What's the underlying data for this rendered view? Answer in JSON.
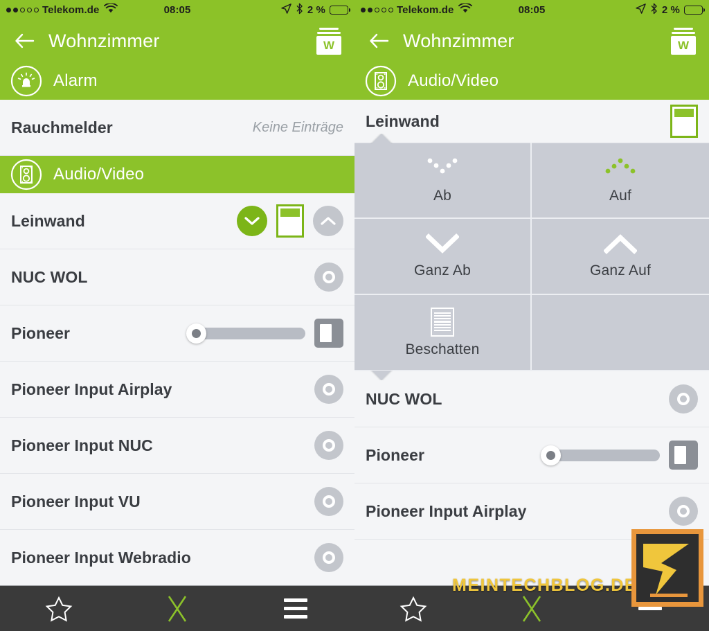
{
  "statusbar": {
    "carrier": "Telekom.de",
    "signal_dots_filled": 2,
    "signal_dots_total": 5,
    "wifi_icon": "wifi-icon",
    "time": "08:05",
    "location_icon": "location-arrow-icon",
    "bluetooth_icon": "bluetooth-icon",
    "battery_percent": "2 %",
    "battery_icon": "battery-empty-icon"
  },
  "navbar": {
    "back_icon": "back-arrow-icon",
    "title": "Wohnzimmer",
    "app_icon_letter": "W",
    "app_icon_name": "wiser-box-icon"
  },
  "colors": {
    "brand_green": "#8cc22a",
    "accent_green": "#7cb518",
    "panel_grey": "#c9ccd4",
    "row_bg": "#f4f5f7",
    "tabbar_bg": "#3a3a3a",
    "text_dark": "#3a3d42",
    "muted_text": "#9aa0a6",
    "watermark_yellow": "#f0c63c",
    "watermark_orange": "#e8963c"
  },
  "left_pane": {
    "categories": [
      {
        "label": "Alarm",
        "icon": "alarm-siren-icon",
        "active": true
      },
      {
        "label": "Audio/Video",
        "icon": "speaker-icon",
        "active": true
      }
    ],
    "alarm_rows": [
      {
        "name": "Rauchmelder",
        "note": "Keine Einträge",
        "control": "none"
      }
    ],
    "av_rows": [
      {
        "name": "Leinwand",
        "control": "screen-controls"
      },
      {
        "name": "NUC WOL",
        "control": "power-toggle"
      },
      {
        "name": "Pioneer",
        "control": "volume-slider"
      },
      {
        "name": "Pioneer Input Airplay",
        "control": "power-toggle"
      },
      {
        "name": "Pioneer Input NUC",
        "control": "power-toggle"
      },
      {
        "name": "Pioneer Input VU",
        "control": "power-toggle"
      },
      {
        "name": "Pioneer Input Webradio",
        "control": "power-toggle"
      }
    ],
    "leinwand_controls": {
      "down_button": "chevron-down-icon",
      "state_icon": "screen-partial-icon",
      "up_button": "chevron-up-icon"
    }
  },
  "right_pane": {
    "category": {
      "label": "Audio/Video",
      "icon": "speaker-icon"
    },
    "expanded_row": {
      "name": "Leinwand",
      "state_icon": "screen-partial-icon"
    },
    "panel_buttons": [
      {
        "label": "Ab",
        "icon": "dotted-chevron-down-icon",
        "icon_color": "#ffffff"
      },
      {
        "label": "Auf",
        "icon": "dotted-chevron-up-icon",
        "icon_color": "#8cc22a"
      },
      {
        "label": "Ganz Ab",
        "icon": "chevron-down-icon",
        "icon_color": "#ffffff"
      },
      {
        "label": "Ganz Auf",
        "icon": "chevron-up-icon",
        "icon_color": "#ffffff"
      },
      {
        "label": "Beschatten",
        "icon": "blinds-slats-icon",
        "icon_color": "#ffffff"
      },
      {
        "label": "",
        "icon": "",
        "icon_color": ""
      }
    ],
    "rows": [
      {
        "name": "NUC WOL",
        "control": "power-toggle"
      },
      {
        "name": "Pioneer",
        "control": "volume-slider"
      },
      {
        "name": "Pioneer Input Airplay",
        "control": "power-toggle"
      }
    ]
  },
  "tabbar": {
    "left_items": [
      {
        "icon": "star-icon",
        "color": "#ffffff"
      },
      {
        "icon": "x-icon",
        "color": "#8cc22a"
      },
      {
        "icon": "hamburger-menu-icon",
        "color": "#ffffff"
      }
    ],
    "right_items": [
      {
        "icon": "star-icon",
        "color": "#ffffff"
      },
      {
        "icon": "x-icon",
        "color": "#8cc22a"
      },
      {
        "icon": "minus-icon",
        "color": "#ffffff"
      }
    ]
  },
  "watermark": {
    "text": "MEINTECHBLOG.DE",
    "logo_name": "meintechblog-logo"
  }
}
